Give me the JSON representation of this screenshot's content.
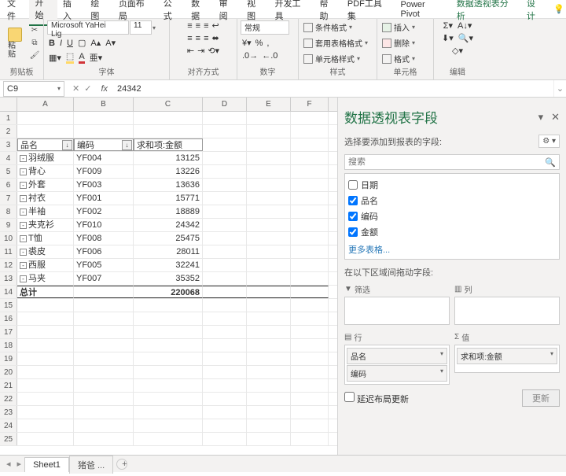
{
  "tabs": [
    "文件",
    "开始",
    "插入",
    "绘图",
    "页面布局",
    "公式",
    "数据",
    "审阅",
    "视图",
    "开发工具",
    "帮助",
    "PDF工具集",
    "Power Pivot"
  ],
  "context_tabs": [
    "数据透视表分析",
    "设计"
  ],
  "active_tab": "开始",
  "ribbon": {
    "clipboard": {
      "label": "剪贴板",
      "paste": "粘贴"
    },
    "font": {
      "label": "字体",
      "family": "Microsoft YaHei Lig",
      "size": "11"
    },
    "align": {
      "label": "对齐方式"
    },
    "number": {
      "label": "数字",
      "format": "常规"
    },
    "styles": {
      "label": "样式",
      "cond": "条件格式",
      "tbl": "套用表格格式",
      "cell": "单元格样式"
    },
    "cells": {
      "label": "单元格",
      "insert": "插入",
      "delete": "删除",
      "format": "格式"
    },
    "edit": {
      "label": "编辑"
    }
  },
  "namebox": "C9",
  "formula": "24342",
  "columns": [
    "A",
    "B",
    "C",
    "D",
    "E",
    "F"
  ],
  "pivot_headers": {
    "col1": "品名",
    "col2": "编码",
    "col3": "求和项:金额"
  },
  "rows": [
    {
      "n": "羽绒服",
      "c": "YF004",
      "v": "13125"
    },
    {
      "n": "背心",
      "c": "YF009",
      "v": "13226"
    },
    {
      "n": "外套",
      "c": "YF003",
      "v": "13636"
    },
    {
      "n": "衬衣",
      "c": "YF001",
      "v": "15771"
    },
    {
      "n": "半袖",
      "c": "YF002",
      "v": "18889"
    },
    {
      "n": "夹克衫",
      "c": "YF010",
      "v": "24342"
    },
    {
      "n": "T恤",
      "c": "YF008",
      "v": "25475"
    },
    {
      "n": "裘皮",
      "c": "YF006",
      "v": "28011"
    },
    {
      "n": "西服",
      "c": "YF005",
      "v": "32241"
    },
    {
      "n": "马夹",
      "c": "YF007",
      "v": "35352"
    }
  ],
  "total": {
    "label": "总计",
    "value": "220068"
  },
  "pane": {
    "title": "数据透视表字段",
    "sub": "选择要添加到报表的字段:",
    "search_ph": "搜索",
    "fields": [
      {
        "label": "日期",
        "checked": false
      },
      {
        "label": "品名",
        "checked": true
      },
      {
        "label": "编码",
        "checked": true
      },
      {
        "label": "金额",
        "checked": true
      }
    ],
    "more": "更多表格...",
    "areas_label": "在以下区域间拖动字段:",
    "filter": "筛选",
    "cols": "列",
    "rows_t": "行",
    "vals": "值",
    "row_items": [
      "品名",
      "编码"
    ],
    "val_items": [
      "求和项:金额"
    ],
    "defer": "延迟布局更新",
    "update": "更新"
  },
  "sheets": {
    "s1": "Sheet1",
    "s2": "猪爸 ...",
    "nav": ""
  }
}
